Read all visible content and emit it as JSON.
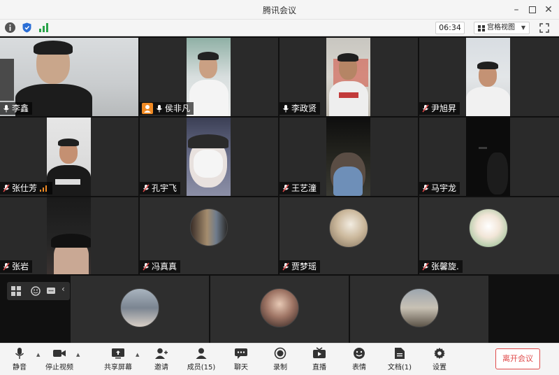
{
  "window": {
    "title": "腾讯会议"
  },
  "infobar": {
    "timer": "06:34",
    "view_mode": "宫格视图"
  },
  "participants": [
    {
      "name": "李鑫"
    },
    {
      "name": "侯非凡"
    },
    {
      "name": "李政贤"
    },
    {
      "name": "尹旭昇"
    },
    {
      "name": "张仕芳"
    },
    {
      "name": "孔宇飞"
    },
    {
      "name": "王艺潼"
    },
    {
      "name": "马宇龙"
    },
    {
      "name": "张岩"
    },
    {
      "name": "冯真真"
    },
    {
      "name": "贾梦瑶"
    },
    {
      "name": "张馨旋."
    }
  ],
  "toolbar": {
    "mute": "静音",
    "stop_video": "停止视频",
    "share_screen": "共享屏幕",
    "invite": "邀请",
    "members": "成员(15)",
    "chat": "聊天",
    "record": "录制",
    "live": "直播",
    "reactions": "表情",
    "docs": "文档(1)",
    "settings": "设置",
    "leave": "离开会议"
  },
  "colors": {
    "accent_red": "#e04a4a",
    "accent_blue": "#2b6fd6",
    "signal_green": "#2aa44a",
    "host_orange": "#f08a24",
    "tile_bg": "#2a2a2a"
  }
}
